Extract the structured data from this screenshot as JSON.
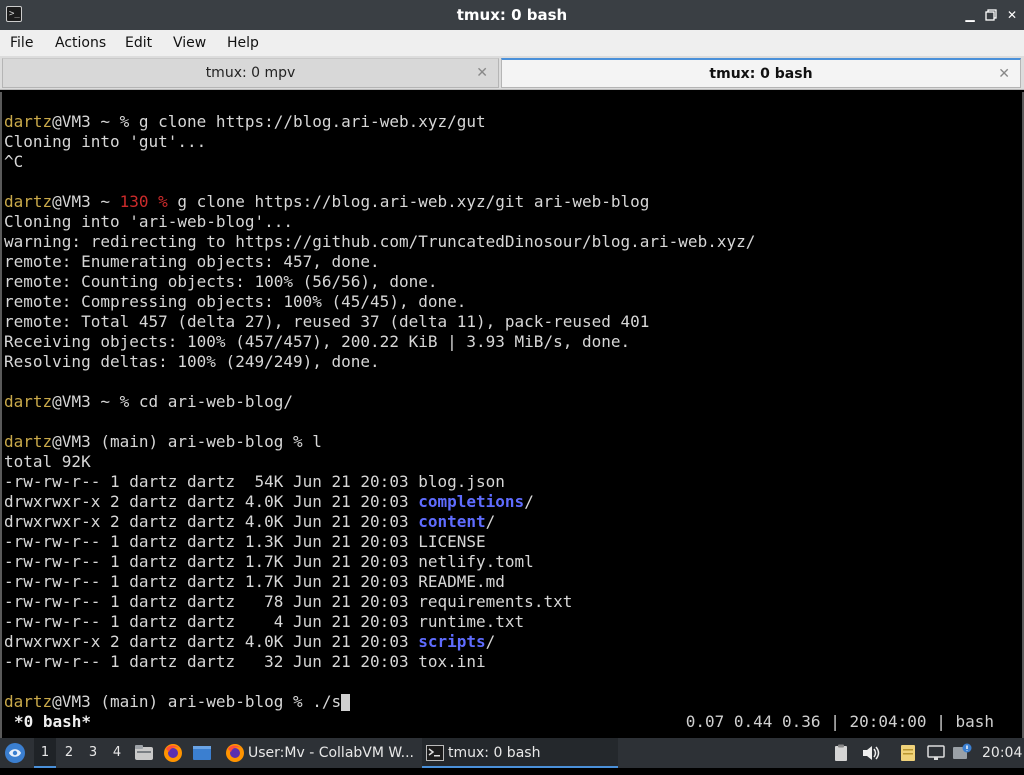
{
  "window": {
    "title": "tmux: 0 bash",
    "app_icon_glyph": ">_",
    "controls": [
      "minimize-icon",
      "restore-icon",
      "close-icon"
    ]
  },
  "menu": {
    "items": [
      "File",
      "Actions",
      "Edit",
      "View",
      "Help"
    ]
  },
  "tabs": [
    {
      "label": "tmux: 0 mpv",
      "active": false
    },
    {
      "label": "tmux: 0 bash",
      "active": true
    }
  ],
  "terminal": {
    "user": "dartz",
    "lines": [
      {
        "prompt": "dartz",
        "rest": "@VM3 ~ % g clone https://blog.ari-web.xyz/gut"
      },
      {
        "text": "Cloning into 'gut'..."
      },
      {
        "text": "^C"
      },
      {
        "prompt": "dartz",
        "rest_a": "@VM3 ~ ",
        "code": "130 %",
        "rest_b": " g clone https://blog.ari-web.xyz/git ari-web-blog"
      },
      {
        "text": "Cloning into 'ari-web-blog'..."
      },
      {
        "text": "warning: redirecting to https://github.com/TruncatedDinosour/blog.ari-web.xyz/"
      },
      {
        "text": "remote: Enumerating objects: 457, done."
      },
      {
        "text": "remote: Counting objects: 100% (56/56), done."
      },
      {
        "text": "remote: Compressing objects: 100% (45/45), done."
      },
      {
        "text": "remote: Total 457 (delta 27), reused 37 (delta 11), pack-reused 401"
      },
      {
        "text": "Receiving objects: 100% (457/457), 200.22 KiB | 3.93 MiB/s, done."
      },
      {
        "text": "Resolving deltas: 100% (249/249), done."
      },
      {
        "prompt": "dartz",
        "rest": "@VM3 ~ % cd ari-web-blog/"
      },
      {
        "prompt": "dartz",
        "rest": "@VM3 (main) ari-web-blog % l"
      },
      {
        "text": "total 92K"
      },
      {
        "meta": "-rw-rw-r-- 1 dartz dartz  54K Jun 21 20:03 ",
        "name": "blog.json",
        "is_dir": false
      },
      {
        "meta": "drwxrwxr-x 2 dartz dartz 4.0K Jun 21 20:03 ",
        "name": "completions",
        "is_dir": true
      },
      {
        "meta": "drwxrwxr-x 2 dartz dartz 4.0K Jun 21 20:03 ",
        "name": "content",
        "is_dir": true
      },
      {
        "meta": "-rw-rw-r-- 1 dartz dartz 1.3K Jun 21 20:03 ",
        "name": "LICENSE",
        "is_dir": false
      },
      {
        "meta": "-rw-rw-r-- 1 dartz dartz 1.7K Jun 21 20:03 ",
        "name": "netlify.toml",
        "is_dir": false
      },
      {
        "meta": "-rw-rw-r-- 1 dartz dartz 1.7K Jun 21 20:03 ",
        "name": "README.md",
        "is_dir": false
      },
      {
        "meta": "-rw-rw-r-- 1 dartz dartz   78 Jun 21 20:03 ",
        "name": "requirements.txt",
        "is_dir": false
      },
      {
        "meta": "-rw-rw-r-- 1 dartz dartz    4 Jun 21 20:03 ",
        "name": "runtime.txt",
        "is_dir": false
      },
      {
        "meta": "drwxrwxr-x 2 dartz dartz 4.0K Jun 21 20:03 ",
        "name": "scripts",
        "is_dir": true
      },
      {
        "meta": "-rw-rw-r-- 1 dartz dartz   32 Jun 21 20:03 ",
        "name": "tox.ini",
        "is_dir": false
      },
      {
        "prompt": "dartz",
        "rest": "@VM3 (main) ari-web-blog % ./s",
        "cursor": true
      }
    ],
    "dir_suffix": "/"
  },
  "tmux_status": {
    "window": "*0 bash*",
    "load": "0.07 0.44 0.36",
    "time": "20:04:00",
    "session": "bash",
    "separator": "|"
  },
  "taskbar": {
    "workspaces": [
      "1",
      "2",
      "3",
      "4"
    ],
    "active_workspace": "1",
    "tasks": [
      {
        "label": "User:Mv - CollabVM W...",
        "icon": "firefox-icon",
        "active": false
      },
      {
        "label": "tmux: 0 bash",
        "icon": "terminal-icon",
        "active": true
      }
    ],
    "clock": "20:04"
  }
}
